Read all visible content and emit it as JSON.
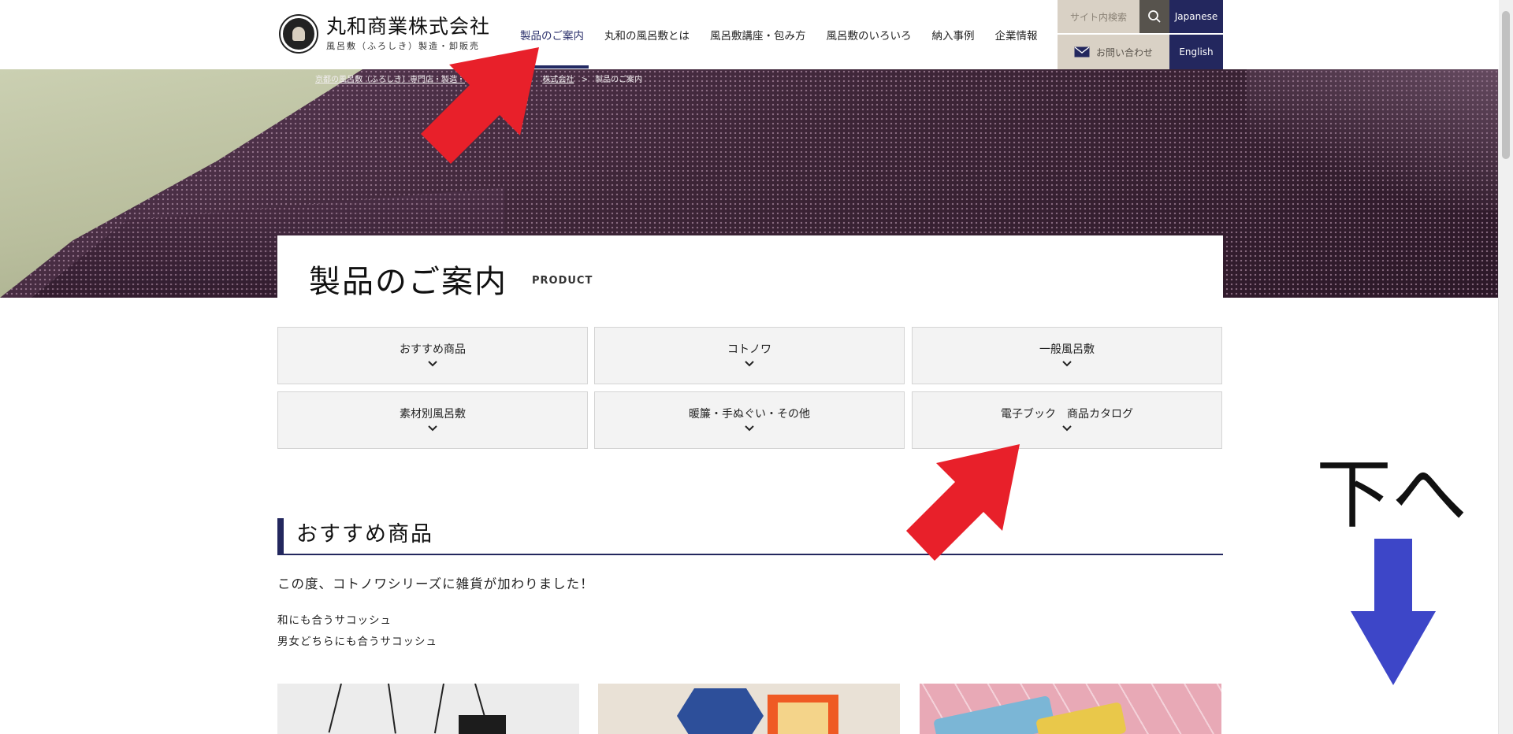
{
  "header": {
    "logo": {
      "title": "丸和商業株式会社",
      "subtitle": "風呂敷（ふろしき）製造・卸販売"
    },
    "nav": [
      {
        "label": "製品のご案内",
        "active": true
      },
      {
        "label": "丸和の風呂敷とは",
        "active": false
      },
      {
        "label": "風呂敷講座・包み方",
        "active": false
      },
      {
        "label": "風呂敷のいろいろ",
        "active": false
      },
      {
        "label": "納入事例",
        "active": false
      },
      {
        "label": "企業情報",
        "active": false
      }
    ],
    "search": {
      "placeholder": "サイト内検索",
      "icon": "search-icon"
    },
    "contact": {
      "label": "お問い合わせ",
      "icon": "mail-icon"
    },
    "languages": {
      "japanese": "Japanese",
      "english": "English"
    }
  },
  "breadcrumb": {
    "items": [
      "京都の風呂敷（ふろしき）専門店・製造・",
      "株式会社",
      "製品のご案内"
    ],
    "separator": ">"
  },
  "page": {
    "title": "製品のご案内",
    "title_en": "PRODUCT"
  },
  "categories": [
    {
      "label": "おすすめ商品"
    },
    {
      "label": "コトノワ"
    },
    {
      "label": "一般風呂敷"
    },
    {
      "label": "素材別風呂敷"
    },
    {
      "label": "暖簾・手ぬぐい・その他"
    },
    {
      "label": "電子ブック　商品カタログ"
    }
  ],
  "section": {
    "title": "おすすめ商品",
    "lead": "この度、コトノワシリーズに雑貨が加わりました！",
    "lines": [
      "和にも合うサコッシュ",
      "男女どちらにも合うサコッシュ"
    ]
  },
  "annotations": {
    "down_label": "下へ"
  },
  "colors": {
    "navy": "#23275e",
    "beige": "#d9d1c5",
    "annotation_red": "#e8202a",
    "annotation_blue": "#3d46c8"
  }
}
